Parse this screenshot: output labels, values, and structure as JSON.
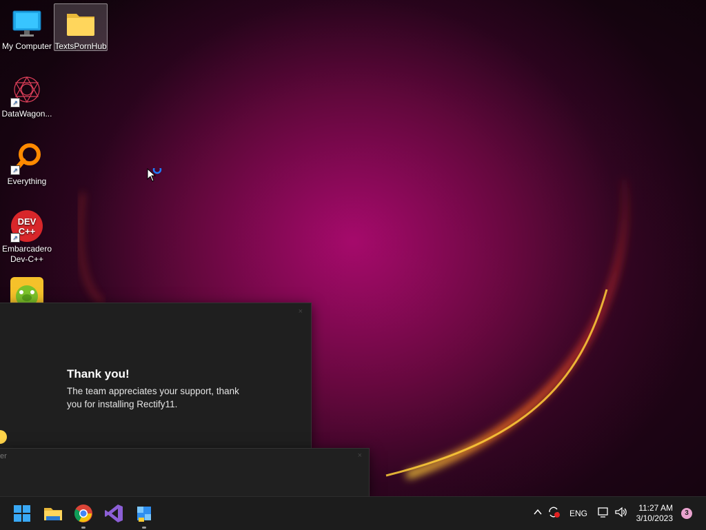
{
  "desktop": {
    "icons": [
      {
        "label": "My Computer",
        "icon": "monitor-icon"
      },
      {
        "label": "TextsPornHub",
        "icon": "folder-icon",
        "selected": true
      },
      {
        "label": "DataWagon...",
        "icon": "datawagon-icon"
      },
      {
        "label": "Everything",
        "icon": "search-magnifier-icon"
      },
      {
        "label": "Embarcadero Dev-C++",
        "icon": "devcpp-icon",
        "logo_text": "DEV C++"
      },
      {
        "label": "",
        "icon": "bad-piggies-icon"
      }
    ]
  },
  "popup": {
    "title": "Thank you!",
    "message": "The team appreciates your support, thank you for installing Rectify11.",
    "close_glyph": "×"
  },
  "second_window": {
    "fragment": "er",
    "close_glyph": "×"
  },
  "taskbar": {
    "apps": [
      {
        "name": "Start",
        "icon": "windows-start-icon"
      },
      {
        "name": "File Explorer",
        "icon": "file-explorer-icon"
      },
      {
        "name": "Google Chrome",
        "icon": "chrome-icon",
        "running": true
      },
      {
        "name": "Visual Studio",
        "icon": "visual-studio-icon"
      },
      {
        "name": "Rectify11 Installer",
        "icon": "installer-icon",
        "running": true
      }
    ],
    "tray": {
      "language": "ENG",
      "time": "11:27 AM",
      "date": "3/10/2023",
      "notifications": "3"
    }
  },
  "colors": {
    "taskbar_bg": "#1c1c1c",
    "window_bg": "#1f1f1f",
    "accent_blue": "#0078d4"
  }
}
